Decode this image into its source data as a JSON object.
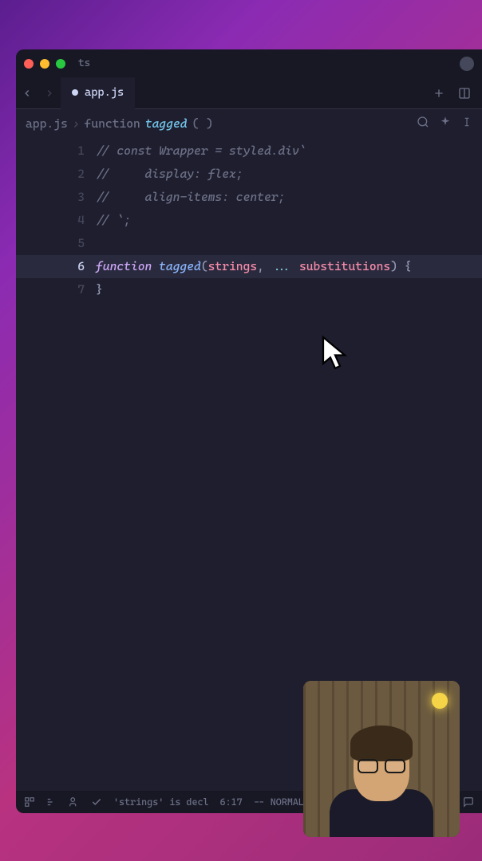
{
  "window": {
    "title": "ts"
  },
  "tabs": {
    "active": {
      "label": "app.js",
      "modified": true
    }
  },
  "breadcrumb": {
    "file": "app.js",
    "separator": "›",
    "keyword": "function",
    "function": "tagged",
    "params": "( )"
  },
  "code": {
    "lines": [
      {
        "n": 1,
        "tokens": [
          {
            "t": "comment",
            "v": "// const Wrapper = styled.div`"
          }
        ]
      },
      {
        "n": 2,
        "tokens": [
          {
            "t": "comment",
            "v": "//     display: flex;"
          }
        ]
      },
      {
        "n": 3,
        "tokens": [
          {
            "t": "comment",
            "v": "//     align-items: center;"
          }
        ]
      },
      {
        "n": 4,
        "tokens": [
          {
            "t": "comment",
            "v": "// `;"
          }
        ]
      },
      {
        "n": 5,
        "tokens": []
      },
      {
        "n": 6,
        "active": true,
        "tokens": [
          {
            "t": "keyword",
            "v": "function"
          },
          {
            "t": "text",
            "v": " "
          },
          {
            "t": "fn",
            "v": "tagged"
          },
          {
            "t": "punct",
            "v": "("
          },
          {
            "t": "param",
            "v": "strings"
          },
          {
            "t": "punct",
            "v": ","
          },
          {
            "t": "text",
            "v": " "
          },
          {
            "t": "op",
            "v": "..."
          },
          {
            "t": "text",
            "v": " "
          },
          {
            "t": "param",
            "v": "substitutions"
          },
          {
            "t": "punct",
            "v": ")"
          },
          {
            "t": "text",
            "v": " "
          },
          {
            "t": "punct",
            "v": "{"
          }
        ]
      },
      {
        "n": 7,
        "tokens": [
          {
            "t": "punct",
            "v": "}"
          }
        ]
      }
    ]
  },
  "statusbar": {
    "diagnostic": "'strings' is decl",
    "position": "6:17",
    "mode": "-- NORMAL --"
  }
}
